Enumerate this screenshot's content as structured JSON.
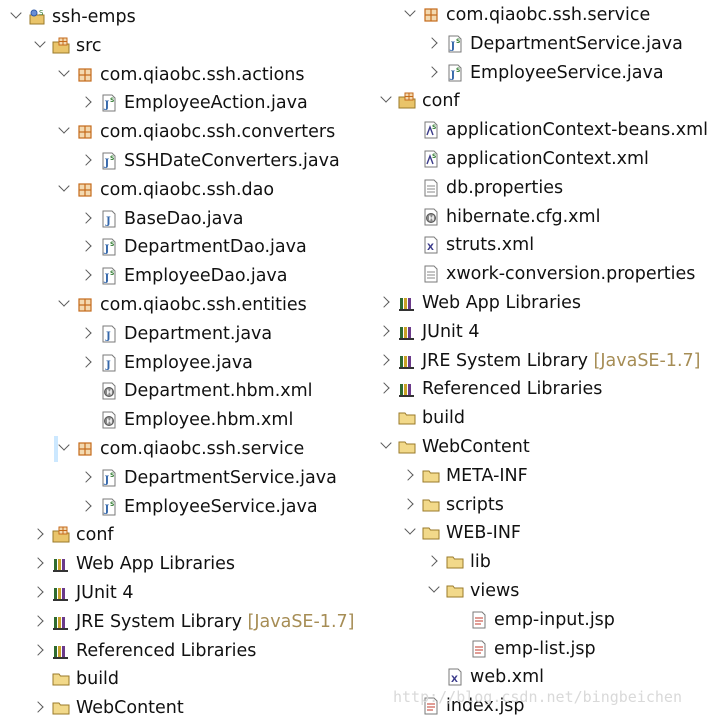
{
  "tree_left": [
    {
      "label": "ssh-emps",
      "icon": "project-icon",
      "depth": 0,
      "state": "expanded"
    },
    {
      "label": "src",
      "icon": "source-folder-icon",
      "depth": 1,
      "state": "expanded"
    },
    {
      "label": "com.qiaobc.ssh.actions",
      "icon": "package-icon",
      "depth": 2,
      "state": "expanded"
    },
    {
      "label": "EmployeeAction.java",
      "icon": "java-spring-file-icon",
      "depth": 3,
      "state": "collapsed"
    },
    {
      "label": "com.qiaobc.ssh.converters",
      "icon": "package-icon",
      "depth": 2,
      "state": "expanded"
    },
    {
      "label": "SSHDateConverters.java",
      "icon": "java-spring-file-icon",
      "depth": 3,
      "state": "collapsed"
    },
    {
      "label": "com.qiaobc.ssh.dao",
      "icon": "package-icon",
      "depth": 2,
      "state": "expanded"
    },
    {
      "label": "BaseDao.java",
      "icon": "java-file-icon",
      "depth": 3,
      "state": "collapsed"
    },
    {
      "label": "DepartmentDao.java",
      "icon": "java-spring-file-icon",
      "depth": 3,
      "state": "collapsed"
    },
    {
      "label": "EmployeeDao.java",
      "icon": "java-spring-file-icon",
      "depth": 3,
      "state": "collapsed"
    },
    {
      "label": "com.qiaobc.ssh.entities",
      "icon": "package-icon",
      "depth": 2,
      "state": "expanded"
    },
    {
      "label": "Department.java",
      "icon": "java-file-icon",
      "depth": 3,
      "state": "collapsed"
    },
    {
      "label": "Employee.java",
      "icon": "java-file-icon",
      "depth": 3,
      "state": "collapsed"
    },
    {
      "label": "Department.hbm.xml",
      "icon": "hibernate-file-icon",
      "depth": 3,
      "state": "none"
    },
    {
      "label": "Employee.hbm.xml",
      "icon": "hibernate-file-icon",
      "depth": 3,
      "state": "none"
    },
    {
      "label": "com.qiaobc.ssh.service",
      "icon": "package-icon",
      "depth": 2,
      "state": "expanded",
      "selected": true
    },
    {
      "label": "DepartmentService.java",
      "icon": "java-spring-file-icon",
      "depth": 3,
      "state": "collapsed"
    },
    {
      "label": "EmployeeService.java",
      "icon": "java-spring-file-icon",
      "depth": 3,
      "state": "collapsed"
    },
    {
      "label": "conf",
      "icon": "source-folder-icon",
      "depth": 1,
      "state": "collapsed"
    },
    {
      "label": "Web App Libraries",
      "icon": "library-icon",
      "depth": 1,
      "state": "collapsed"
    },
    {
      "label": "JUnit 4",
      "icon": "library-icon",
      "depth": 1,
      "state": "collapsed"
    },
    {
      "label": "JRE System Library",
      "icon": "library-icon",
      "depth": 1,
      "state": "collapsed",
      "decoration": "[JavaSE-1.7]"
    },
    {
      "label": "Referenced Libraries",
      "icon": "library-icon",
      "depth": 1,
      "state": "collapsed"
    },
    {
      "label": "build",
      "icon": "folder-icon",
      "depth": 1,
      "state": "none"
    },
    {
      "label": "WebContent",
      "icon": "folder-icon",
      "depth": 1,
      "state": "collapsed"
    }
  ],
  "tree_right": [
    {
      "label": "com.qiaobc.ssh.service",
      "icon": "package-icon",
      "depth": 1,
      "state": "expanded"
    },
    {
      "label": "DepartmentService.java",
      "icon": "java-spring-file-icon",
      "depth": 2,
      "state": "collapsed"
    },
    {
      "label": "EmployeeService.java",
      "icon": "java-spring-file-icon",
      "depth": 2,
      "state": "collapsed"
    },
    {
      "label": "conf",
      "icon": "source-folder-icon",
      "depth": 0,
      "state": "expanded"
    },
    {
      "label": "applicationContext-beans.xml",
      "icon": "spring-xml-icon",
      "depth": 1,
      "state": "none"
    },
    {
      "label": "applicationContext.xml",
      "icon": "spring-xml-icon",
      "depth": 1,
      "state": "none"
    },
    {
      "label": "db.properties",
      "icon": "properties-file-icon",
      "depth": 1,
      "state": "none"
    },
    {
      "label": "hibernate.cfg.xml",
      "icon": "hibernate-file-icon",
      "depth": 1,
      "state": "none"
    },
    {
      "label": "struts.xml",
      "icon": "xml-file-icon",
      "depth": 1,
      "state": "none"
    },
    {
      "label": "xwork-conversion.properties",
      "icon": "properties-file-icon",
      "depth": 1,
      "state": "none"
    },
    {
      "label": "Web App Libraries",
      "icon": "library-icon",
      "depth": 0,
      "state": "collapsed"
    },
    {
      "label": "JUnit 4",
      "icon": "library-icon",
      "depth": 0,
      "state": "collapsed"
    },
    {
      "label": "JRE System Library",
      "icon": "library-icon",
      "depth": 0,
      "state": "collapsed",
      "decoration": "[JavaSE-1.7]"
    },
    {
      "label": "Referenced Libraries",
      "icon": "library-icon",
      "depth": 0,
      "state": "collapsed"
    },
    {
      "label": "build",
      "icon": "folder-icon",
      "depth": 0,
      "state": "none"
    },
    {
      "label": "WebContent",
      "icon": "folder-icon",
      "depth": 0,
      "state": "expanded"
    },
    {
      "label": "META-INF",
      "icon": "folder-icon",
      "depth": 1,
      "state": "collapsed"
    },
    {
      "label": "scripts",
      "icon": "folder-icon",
      "depth": 1,
      "state": "collapsed"
    },
    {
      "label": "WEB-INF",
      "icon": "folder-icon",
      "depth": 1,
      "state": "expanded"
    },
    {
      "label": "lib",
      "icon": "folder-icon",
      "depth": 2,
      "state": "collapsed"
    },
    {
      "label": "views",
      "icon": "folder-icon",
      "depth": 2,
      "state": "expanded"
    },
    {
      "label": "emp-input.jsp",
      "icon": "jsp-file-icon",
      "depth": 3,
      "state": "none"
    },
    {
      "label": "emp-list.jsp",
      "icon": "jsp-file-icon",
      "depth": 3,
      "state": "none"
    },
    {
      "label": "web.xml",
      "icon": "xml-file-icon",
      "depth": 2,
      "state": "none"
    },
    {
      "label": "index.jsp",
      "icon": "jsp-file-icon",
      "depth": 1,
      "state": "none"
    }
  ],
  "watermark": "http://blog.csdn.net/bingbeichen",
  "colors": {
    "selection": "#cce8ff",
    "decoration": "#a68d55",
    "package": "#c46a1a",
    "folder": "#e9c46a",
    "java": "#3366aa"
  }
}
